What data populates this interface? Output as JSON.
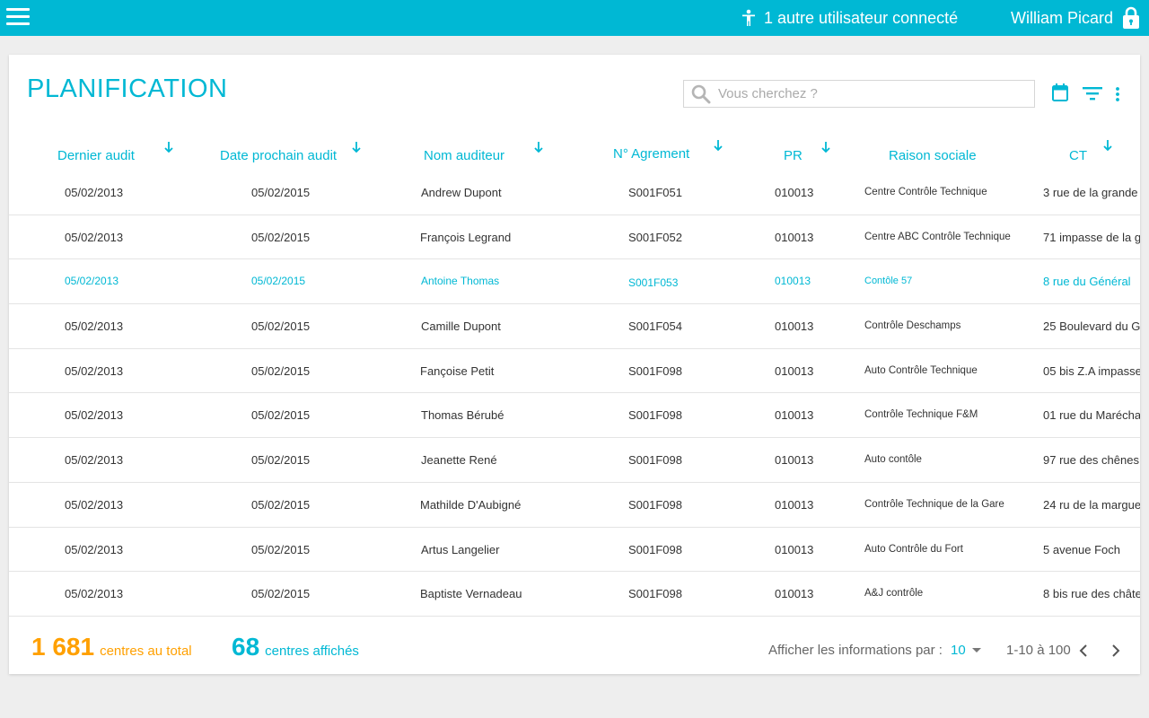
{
  "topbar": {
    "online_users": "1 autre utilisateur connecté",
    "user_name": "William Picard",
    "icons": [
      "menu-icon",
      "person-icon",
      "lock-icon"
    ]
  },
  "page": {
    "title": "PLANIFICATION",
    "search_placeholder": "Vous cherchez ?"
  },
  "columns": [
    "Dernier audit",
    "Date prochain audit",
    "Nom auditeur",
    "N° Agrement",
    "PR",
    "Raison sociale",
    "CT"
  ],
  "rows": [
    [
      "05/02/2013",
      "05/02/2015",
      "Andrew Dupont",
      "S001F051",
      "010013",
      "Centre Contrôle Technique",
      "3 rue de la grande"
    ],
    [
      "05/02/2013",
      "05/02/2015",
      "François Legrand",
      "S001F052",
      "010013",
      "Centre ABC Contrôle Technique",
      "71 impasse de la g"
    ],
    [
      "05/02/2013",
      "05/02/2015",
      "Antoine Thomas",
      "S001F053",
      "010013",
      "Contôle 57",
      "8 rue du Général"
    ],
    [
      "05/02/2013",
      "05/02/2015",
      "Camille Dupont",
      "S001F054",
      "010013",
      "Contrôle Deschamps",
      "25  Boulevard du G"
    ],
    [
      "05/02/2013",
      "05/02/2015",
      "Fançoise Petit",
      "S001F098",
      "010013",
      "Auto Contrôle Technique",
      "05 bis Z.A impasse"
    ],
    [
      "05/02/2013",
      "05/02/2015",
      "Thomas Bérubé",
      "S001F098",
      "010013",
      "Contrôle Technique F&M",
      "01 rue du Marécha"
    ],
    [
      "05/02/2013",
      "05/02/2015",
      "Jeanette René",
      "S001F098",
      "010013",
      "Auto contôle",
      "97 rue des chênes"
    ],
    [
      "05/02/2013",
      "05/02/2015",
      "Mathilde D'Aubigné",
      "S001F098",
      "010013",
      "Contrôle Technique de la Gare",
      "24 ru de la margue"
    ],
    [
      "05/02/2013",
      "05/02/2015",
      "Artus Langelier",
      "S001F098",
      "010013",
      "Auto Contrôle du Fort",
      "5 avenue Foch"
    ],
    [
      "05/02/2013",
      "05/02/2015",
      "Baptiste Vernadeau",
      "S001F098",
      "010013",
      "A&J contrôle",
      "8 bis rue des châte"
    ]
  ],
  "highlighted_row": 2,
  "footer": {
    "total_count": "1 681",
    "total_label": "centres au total",
    "shown_count": "68",
    "shown_label": "centres affichés",
    "per_page_label": "Afficher les informations par :",
    "per_page_value": "10",
    "range": "1-10 à 100"
  },
  "colors": {
    "accent": "#00b8d4",
    "orange": "#ffa000",
    "background": "#eeeeee"
  }
}
